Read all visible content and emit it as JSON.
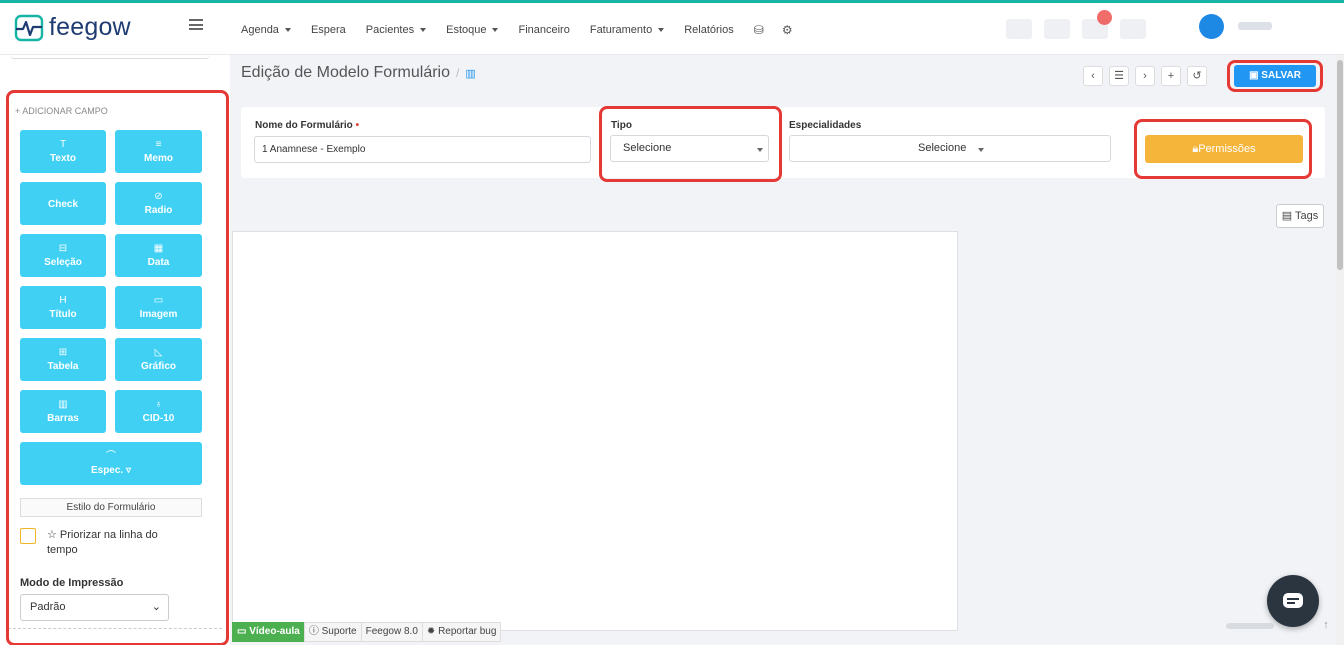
{
  "brand": {
    "name": "feegow",
    "accent": "#16b4a4"
  },
  "nav": {
    "items": [
      "Agenda",
      "Espera",
      "Pacientes",
      "Estoque",
      "Financeiro",
      "Faturamento",
      "Relatórios"
    ],
    "item_has_caret": [
      true,
      false,
      true,
      true,
      false,
      true,
      false
    ],
    "icons": [
      "database-icon",
      "gear-icon"
    ]
  },
  "sidebar": {
    "add_field_title": "+ ADICIONAR CAMPO",
    "fields": [
      {
        "label": "Texto",
        "icon": "T"
      },
      {
        "label": "Memo",
        "icon": "≡"
      },
      {
        "label": "Check",
        "icon": ""
      },
      {
        "label": "Radio",
        "icon": "⊘"
      },
      {
        "label": "Seleção",
        "icon": "⊟"
      },
      {
        "label": "Data",
        "icon": "▦"
      },
      {
        "label": "Título",
        "icon": "H"
      },
      {
        "label": "Imagem",
        "icon": "▭"
      },
      {
        "label": "Tabela",
        "icon": "⊞"
      },
      {
        "label": "Gráfico",
        "icon": "◺"
      },
      {
        "label": "Barras",
        "icon": "▥"
      },
      {
        "label": "CID-10",
        "icon": "♁"
      },
      {
        "label": "Espec. ▿",
        "icon": "⌒"
      }
    ],
    "style_button": "Estilo do Formulário",
    "priority_label": "☆ Priorizar na linha do tempo",
    "print_mode_label": "Modo de Impressão",
    "print_mode_value": "Padrão"
  },
  "header": {
    "title": "Edição de Modelo Formulário",
    "separator": "/",
    "save_label": "SALVAR",
    "tool_icons": [
      "‹",
      "☰",
      "›",
      "+",
      "↺"
    ]
  },
  "form": {
    "name_label": "Nome do Formulário",
    "required_mark": "•",
    "name_value": "1 Anamnese - Exemplo",
    "type_label": "Tipo",
    "type_value": "Selecione",
    "spec_label": "Especialidades",
    "spec_value": "Selecione",
    "permissions_label": "Permissões"
  },
  "tags_label": "Tags",
  "footer": {
    "video": "Vídeo-aula",
    "support": "Suporte",
    "version": "Feegow 8.0",
    "report": "Reportar bug"
  },
  "colors": {
    "field_button": "#3fd0f4",
    "save_button": "#2196f3",
    "permissions_button": "#f5b53b",
    "highlight": "#e53935",
    "video_button": "#4caf50"
  }
}
